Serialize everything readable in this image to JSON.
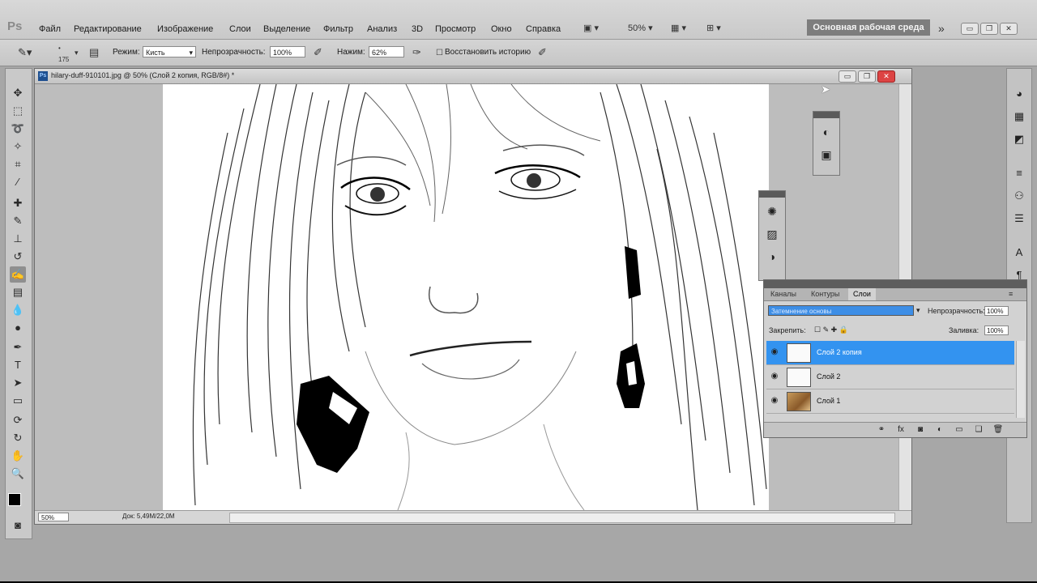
{
  "app": {
    "logo": "Ps"
  },
  "menu": [
    "Файл",
    "Редактирование",
    "Изображение",
    "Слои",
    "Выделение",
    "Фильтр",
    "Анализ",
    "3D",
    "Просмотр",
    "Окно",
    "Справка"
  ],
  "menubar": {
    "zoom": "50%",
    "workspace": "Основная рабочая среда"
  },
  "options": {
    "brush_size": "175",
    "mode_label": "Режим:",
    "mode_value": "Кисть",
    "opacity_label": "Непрозрачность:",
    "opacity_value": "100%",
    "pressure_label": "Нажим:",
    "pressure_value": "62%",
    "history_label": "Восстановить историю"
  },
  "document": {
    "title": "hilary-duff-910101.jpg @ 50% (Слой 2 копия, RGB/8#) *",
    "zoom": "50%",
    "info": "Док: 5,49М/22,0М"
  },
  "layers_panel": {
    "tabs": [
      "Каналы",
      "Контуры",
      "Слои"
    ],
    "active_tab": "Слои",
    "blend_mode": "Затемнение основы",
    "opacity_label": "Непрозрачность:",
    "opacity_value": "100%",
    "lock_label": "Закрепить:",
    "fill_label": "Заливка:",
    "fill_value": "100%",
    "layers": [
      {
        "name": "Слой 2 копия",
        "selected": true,
        "thumb": "sketch"
      },
      {
        "name": "Слой 2",
        "selected": false,
        "thumb": "sketch"
      },
      {
        "name": "Слой 1",
        "selected": false,
        "thumb": "photo"
      }
    ]
  }
}
